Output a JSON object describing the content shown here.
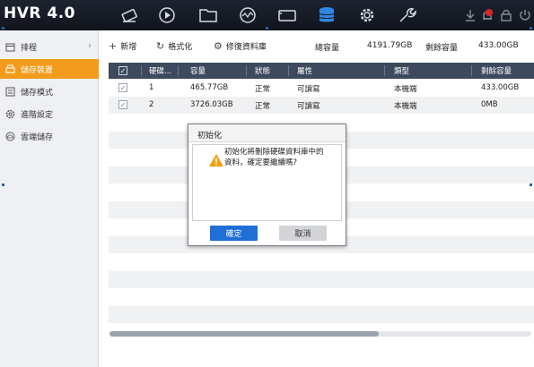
{
  "app": {
    "logo": "HVR 4.0"
  },
  "topnav": {
    "icons": [
      "live-view-icon",
      "playback-icon",
      "file-folder-icon",
      "analytics-icon",
      "camera-icon",
      "storage-icon",
      "settings-gear-icon",
      "maintenance-wrench-icon"
    ],
    "active": "storage-icon",
    "right_icons": [
      "download-icon",
      "alarm-bell-icon",
      "lock-icon",
      "power-icon"
    ]
  },
  "sidebar": {
    "items": [
      {
        "label": "排程",
        "icon": "calendar-icon",
        "has_arrow": true
      },
      {
        "label": "儲存裝置",
        "icon": "hdd-icon",
        "active": true
      },
      {
        "label": "儲存模式",
        "icon": "storage-mode-icon"
      },
      {
        "label": "進階設定",
        "icon": "advanced-gear-icon"
      },
      {
        "label": "雲端儲存",
        "icon": "cloud-icon"
      }
    ],
    "arrow": "›"
  },
  "toolbar": {
    "add_label": "新增",
    "format_label": "格式化",
    "repair_label": "修復資料庫",
    "total_label": "總容量",
    "total_value": "4191.79GB",
    "free_label": "剩餘容量",
    "free_value": "433.00GB"
  },
  "table": {
    "columns": [
      "硬碟...",
      "容量",
      "狀態",
      "屬性",
      "類型",
      "剩餘容量"
    ],
    "rows": [
      {
        "no": "1",
        "capacity": "465.77GB",
        "status": "正常",
        "property": "可讀寫",
        "type": "本機端",
        "free": "433.00GB",
        "checked": true
      },
      {
        "no": "2",
        "capacity": "3726.03GB",
        "status": "正常",
        "property": "可讀寫",
        "type": "本機端",
        "free": "0MB",
        "checked": true
      }
    ],
    "check_mark": "✓"
  },
  "dialog": {
    "title": "初始化",
    "message_line1": "初始化將刪除硬碟資料庫中的",
    "message_line2": "資料，確定要繼續嗎?",
    "ok_label": "確定",
    "cancel_label": "取消"
  },
  "colors": {
    "accent": "#f29b1c",
    "primary_button": "#1f6fd6",
    "topbar": "#161b25",
    "table_header": "#3d4a5e"
  }
}
